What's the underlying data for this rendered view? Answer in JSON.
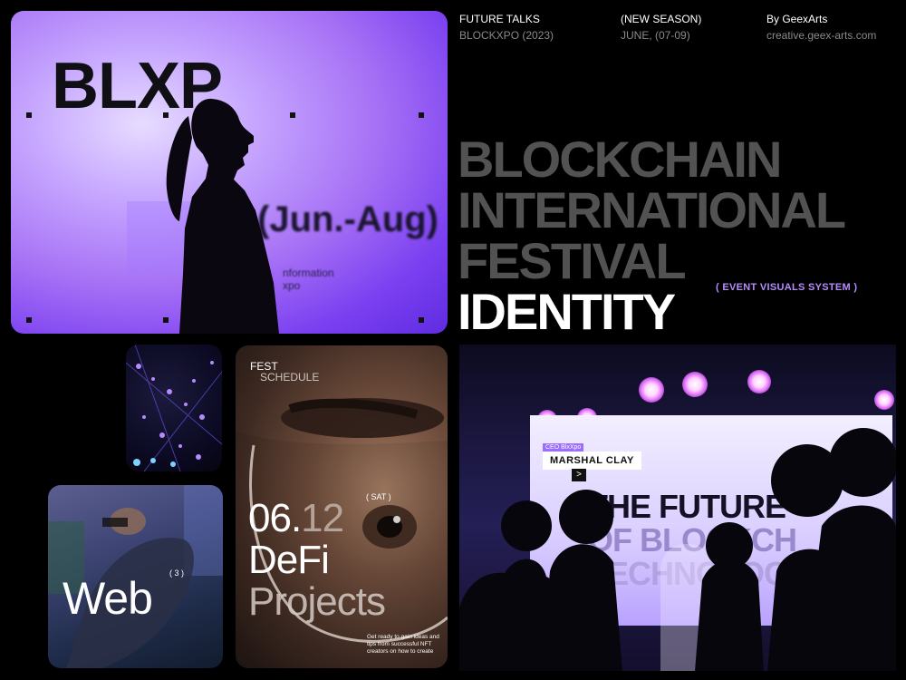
{
  "hero": {
    "brand": "BLXP",
    "range": "(Jun.-Aug)",
    "info_line1": "nformation",
    "info_line2": "xpo"
  },
  "header": {
    "col1_a": "FUTURE TALKS",
    "col1_b": "BLOCKXPO (2023)",
    "col2_a": "(NEW SEASON)",
    "col2_b": "JUNE, (07-09)",
    "col3_a": "By GeexArts",
    "col3_b": "creative.geex-arts.com"
  },
  "title": {
    "line1": "BLOCKCHAIN",
    "line2": "INTERNATIONAL",
    "line3": "FESTIVAL",
    "line4": "IDENTITY",
    "subtitle": "( EVENT VISUALS SYSTEM )"
  },
  "web_tile": {
    "label": "Web",
    "sup": "( 3 )"
  },
  "schedule": {
    "fest": "FEST",
    "schedule": "SCHEDULE",
    "sat": "( SAT )",
    "date_main": "06.",
    "date_faded": "12",
    "line2": "DeFi",
    "line3": "Projects",
    "blurb": "Get ready to gain ideas and tips from successful NFT creators on how to create"
  },
  "stage": {
    "tag": "CEO BlxXpo",
    "speaker": "MARSHAL CLAY",
    "chevron": ">",
    "line1": "THE FUTURE",
    "line2": "OF BLOCKCH",
    "line3": "TECHNOLOG"
  },
  "colors": {
    "background": "#000000",
    "accent": "#b68cff",
    "title_gray": "#525252"
  }
}
